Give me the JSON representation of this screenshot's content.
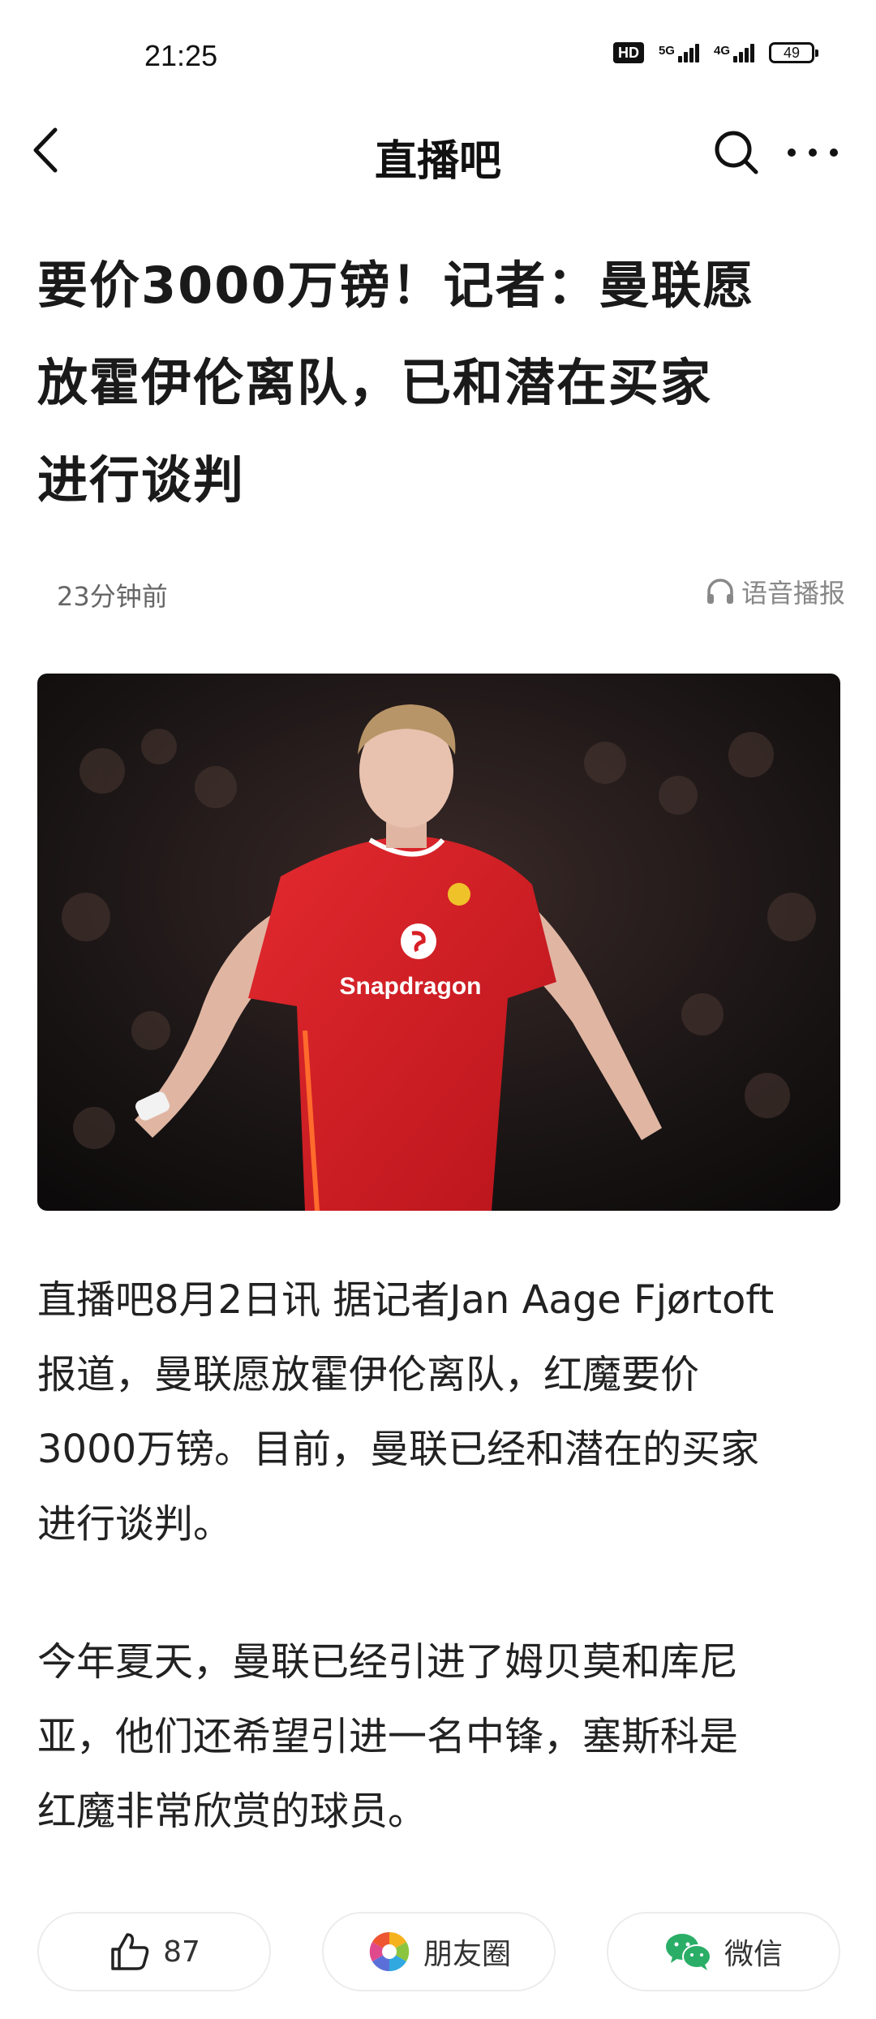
{
  "status_bar": {
    "time": "21:25",
    "hd_label": "HD",
    "network_1": "5G",
    "network_2": "4G",
    "battery": "49"
  },
  "nav": {
    "title": "直播吧",
    "back_icon": "chevron-left-icon",
    "search_icon": "search-icon",
    "more_icon": "more-dots-icon"
  },
  "article": {
    "headline_lines": [
      "要价3000万镑！记者：曼联愿",
      "放霍伊伦离队，已和潜在买家",
      "进行谈判"
    ],
    "published": "23分钟前",
    "audio_label": "语音播报",
    "paragraph_1_lines": [
      "直播吧8月2日讯 据记者Jan Aage Fjørtoft",
      "报道，曼联愿放霍伊伦离队，红魔要价",
      "3000万镑。目前，曼联已经和潜在的买家",
      "进行谈判。"
    ],
    "paragraph_2_lines": [
      "今年夏天，曼联已经引进了姆贝莫和库尼",
      "亚，他们还希望引进一名中锋，塞斯科是",
      "红魔非常欣赏的球员。"
    ],
    "photo_shirt_text": "Snapdragon"
  },
  "actions": {
    "like_count": "87",
    "moments_label": "朋友圈",
    "wechat_label": "微信"
  },
  "colors": {
    "jersey_red": "#d81f26",
    "wechat_green": "#2aae67"
  }
}
